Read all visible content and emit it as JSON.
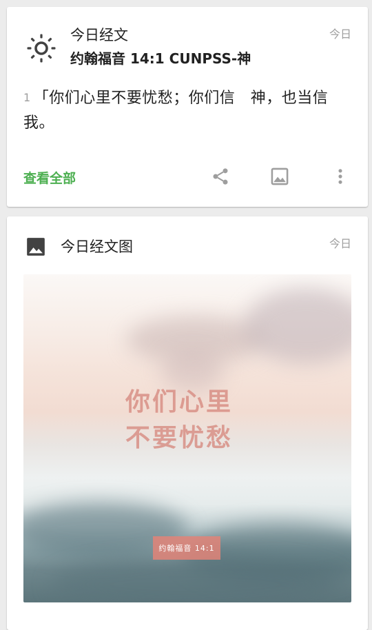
{
  "verse_card": {
    "title": "今日经文",
    "reference": "约翰福音 14:1 CUNPSS-神",
    "date_label": "今日",
    "verse_number": "1",
    "verse_text": "「你们心里不要忧愁；你们信　神，也当信我。",
    "view_all_label": "查看全部",
    "icons": [
      "sun-icon",
      "share-icon",
      "image-icon",
      "more-vert-icon"
    ]
  },
  "image_card": {
    "title": "今日经文图",
    "date_label": "今日",
    "image_text_line1": "你们心里",
    "image_text_line2": "不要忧愁",
    "image_reference": "约翰福音 14:1",
    "icons": [
      "image-icon"
    ]
  },
  "colors": {
    "accent_green": "#4caf50",
    "text_primary": "#212121",
    "text_secondary": "#9e9e9e",
    "background": "#ececec",
    "image_text": "#d78c82"
  }
}
